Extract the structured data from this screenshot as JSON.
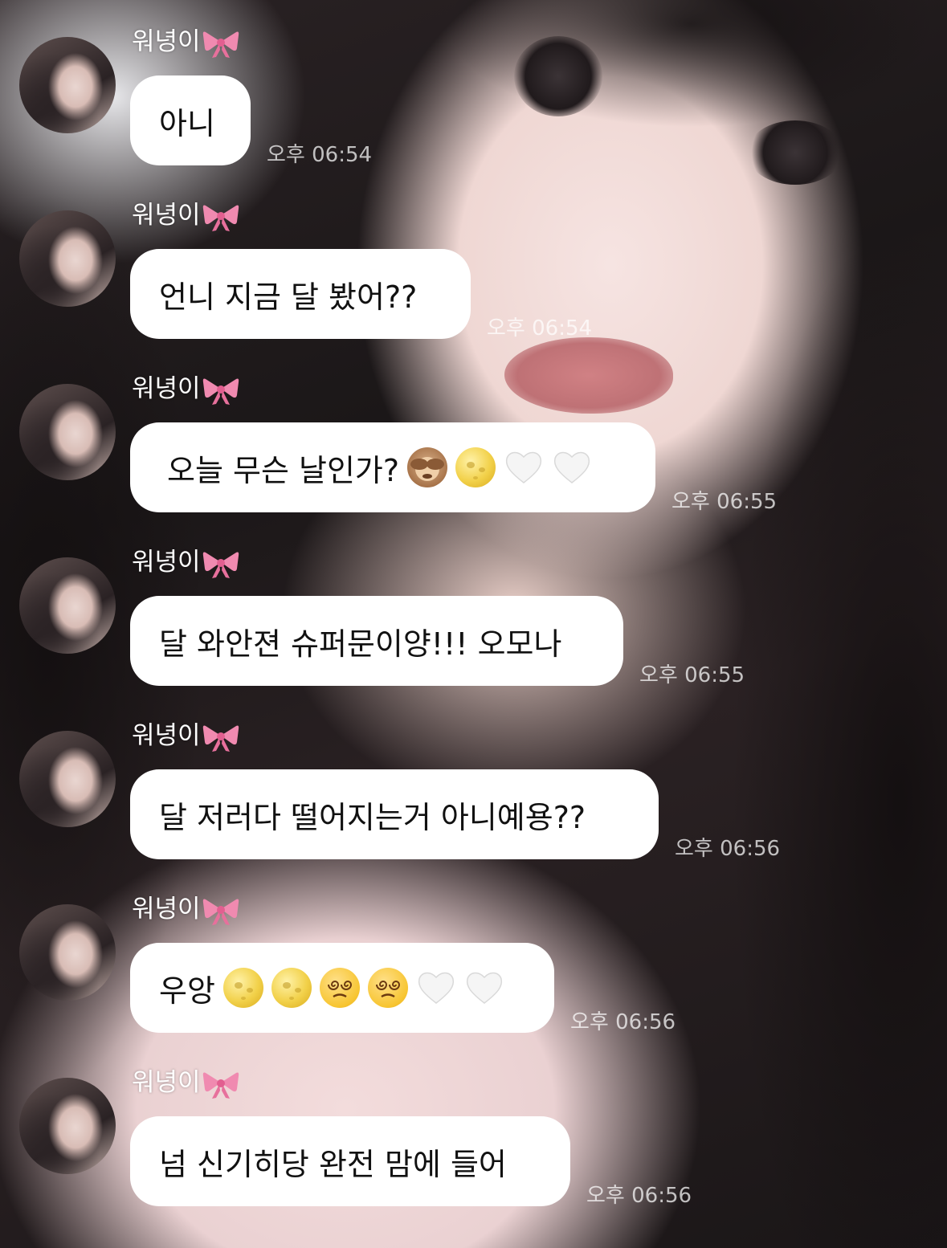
{
  "sender": {
    "name": "워녕이",
    "name_icon": "ribbon-icon"
  },
  "messages": [
    {
      "text": "아니",
      "emojis": [],
      "time": "오후 06:54"
    },
    {
      "text": "언니 지금 달 봤어??",
      "emojis": [],
      "time": "오후 06:54"
    },
    {
      "text": "오늘 무슨 날인가?",
      "emojis": [
        "see-no-evil-monkey-icon",
        "full-moon-face-icon",
        "white-heart-icon",
        "white-heart-icon"
      ],
      "time": "오후 06:55"
    },
    {
      "text": "달 와안젼 슈퍼문이양!!! 오모나",
      "emojis": [],
      "time": "오후 06:55"
    },
    {
      "text": "달 저러다 떨어지는거 아니예용??",
      "emojis": [],
      "time": "오후 06:56"
    },
    {
      "text": "우앙",
      "emojis": [
        "full-moon-face-icon",
        "full-moon-face-icon",
        "dizzy-face-icon",
        "dizzy-face-icon",
        "white-heart-icon",
        "white-heart-icon"
      ],
      "time": "오후 06:56"
    },
    {
      "text": "넘 신기히당 완전 맘에 들어",
      "emojis": [],
      "time": "오후 06:56"
    }
  ],
  "colors": {
    "bubble": "#ffffff",
    "bubble_text": "#111111",
    "name_text": "#ffffff",
    "ribbon": "#f08ab0"
  }
}
